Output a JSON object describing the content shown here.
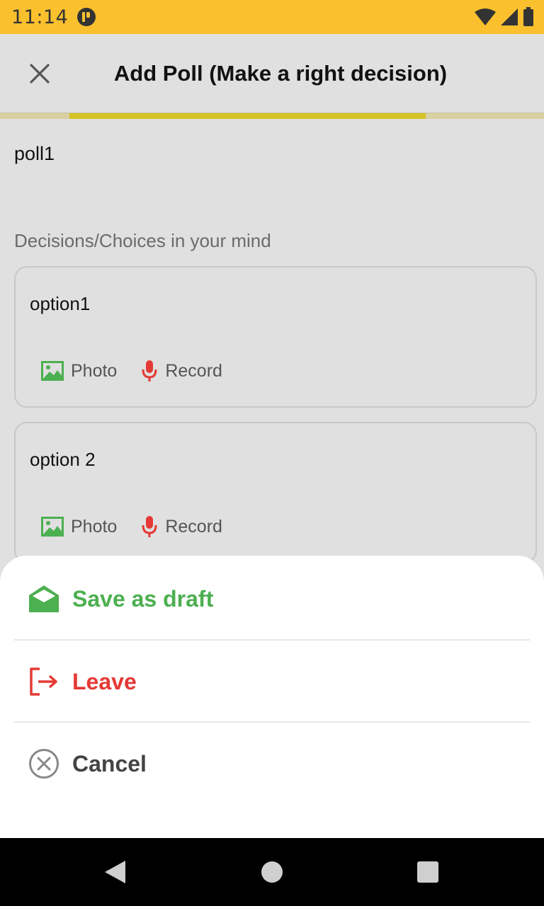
{
  "status_bar": {
    "time": "11:14"
  },
  "app_bar": {
    "title": "Add Poll (Make a right decision)"
  },
  "progress": {
    "fraction": 0.655
  },
  "poll": {
    "title": "poll1",
    "section_label": "Decisions/Choices in your mind",
    "options": [
      {
        "text": "option1",
        "photo_label": "Photo",
        "record_label": "Record"
      },
      {
        "text": "option 2",
        "photo_label": "Photo",
        "record_label": "Record"
      }
    ]
  },
  "sheet": {
    "items": [
      {
        "label": "Save as draft",
        "icon": "draft-envelope-icon",
        "color": "#4caf50"
      },
      {
        "label": "Leave",
        "icon": "leave-exit-icon",
        "color": "#e53935"
      },
      {
        "label": "Cancel",
        "icon": "cancel-circle-icon",
        "color": "#444444"
      }
    ]
  },
  "colors": {
    "status_bar": "#fbc02d",
    "progress_fill": "#d4c323",
    "photo_icon": "#4caf50",
    "record_icon": "#e53935"
  }
}
